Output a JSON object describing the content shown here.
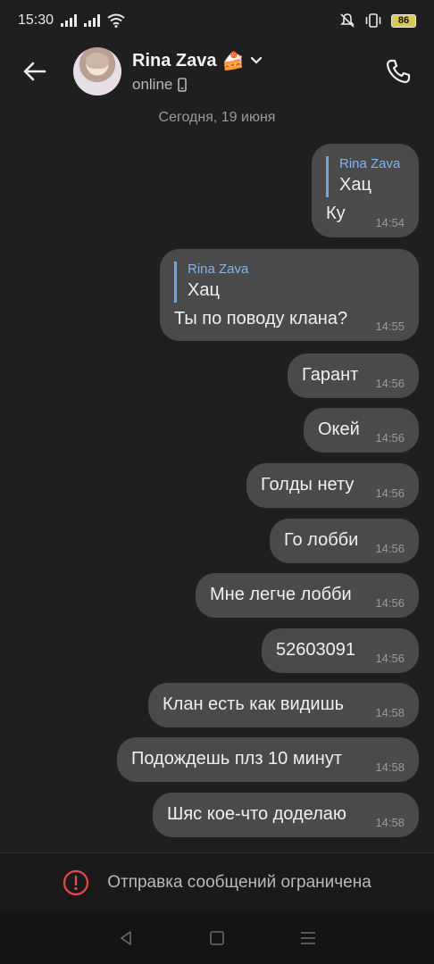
{
  "status": {
    "time": "15:30",
    "battery": "86"
  },
  "header": {
    "name": "Rina Zava",
    "emoji": "🍰",
    "status": "online"
  },
  "date": "Сегодня, 19 июня",
  "messages": [
    {
      "reply_name": "Rina Zava",
      "reply_text": "Хац",
      "text": "Ку",
      "time": "14:54"
    },
    {
      "reply_name": "Rina Zava",
      "reply_text": "Хац",
      "text": "Ты по поводу клана?",
      "time": "14:55"
    },
    {
      "text": "Гарант",
      "time": "14:56"
    },
    {
      "text": "Окей",
      "time": "14:56"
    },
    {
      "text": "Голды нету",
      "time": "14:56"
    },
    {
      "text": "Го лобби",
      "time": "14:56"
    },
    {
      "text": "Мне легче лобби",
      "time": "14:56"
    },
    {
      "text": "52603091",
      "time": "14:56"
    },
    {
      "text": "Клан есть как видишь",
      "time": "14:58"
    },
    {
      "text": "Подождешь плз 10 минут",
      "time": "14:58"
    },
    {
      "text": "Шяс кое-что доделаю",
      "time": "14:58"
    }
  ],
  "banner": {
    "text": "Отправка сообщений ограничена"
  },
  "colors": {
    "bubble": "#4a4a4c",
    "reply_accent": "#6fa6e6",
    "background": "#1f1f1f",
    "warning": "#e5484d"
  }
}
